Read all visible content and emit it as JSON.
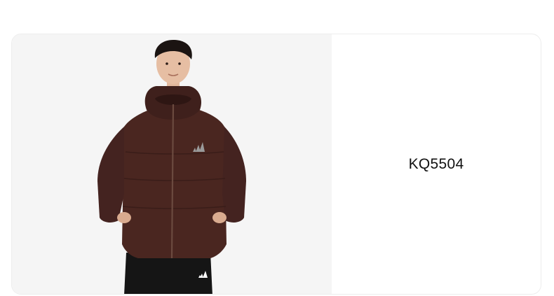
{
  "product": {
    "code": "KQ5504",
    "image_subject": "model-wearing-dark-brown-hooded-down-jacket",
    "colors": {
      "jacket": "#4a2620",
      "image_background": "#f5f5f5",
      "pants": "#151515"
    }
  }
}
